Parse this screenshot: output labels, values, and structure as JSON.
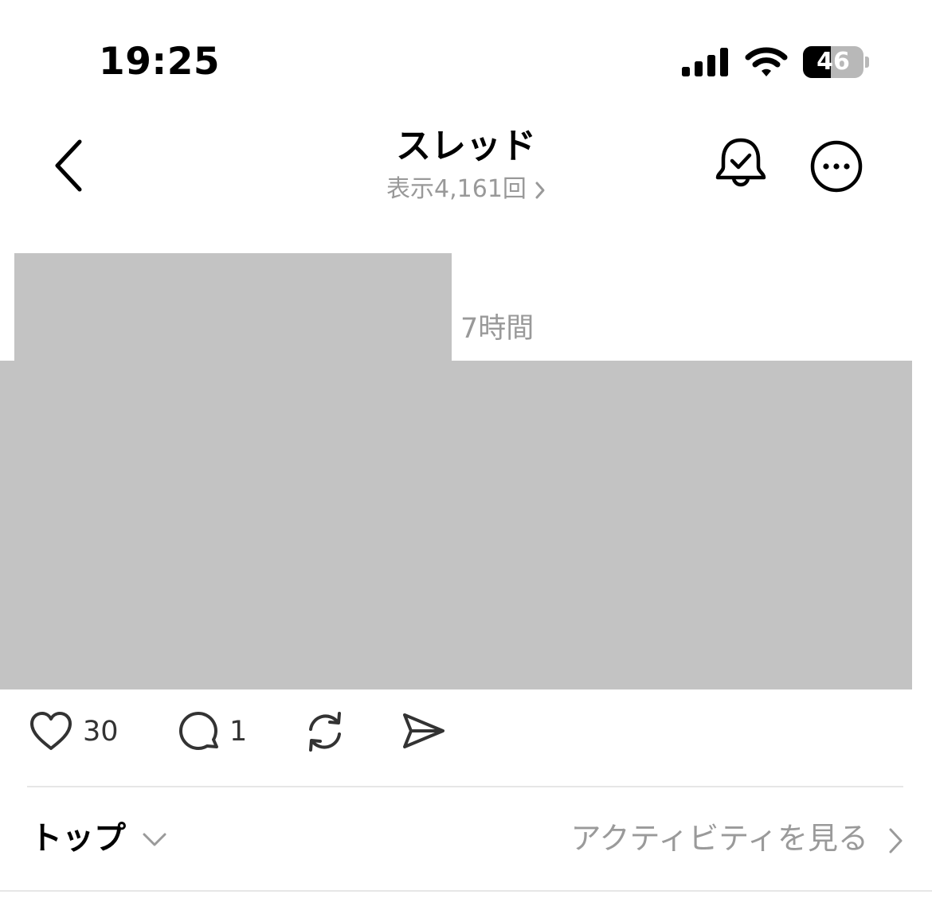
{
  "status_bar": {
    "time": "19:25",
    "battery_level": "46",
    "battery_fraction": 0.46
  },
  "header": {
    "title": "スレッド",
    "views": "表示4,161回"
  },
  "post": {
    "time_ago": "7時間",
    "like_count": "30",
    "reply_count": "1"
  },
  "footer": {
    "sort_label": "トップ",
    "activity_link": "アクティビティを見る"
  },
  "icons": [
    "back-icon",
    "bell-check-icon",
    "more-icon",
    "heart-icon",
    "comment-icon",
    "repost-icon",
    "share-icon",
    "chevron-down-icon",
    "chevron-right-icon"
  ]
}
